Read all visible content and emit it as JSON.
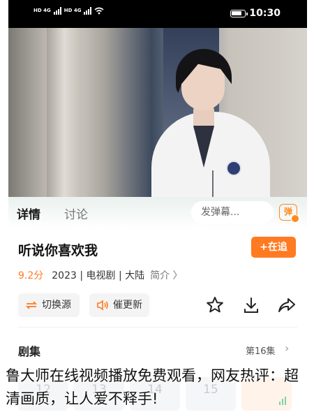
{
  "status_bar": {
    "signal_left": "HD 4G",
    "signal_right": "HD 4G",
    "time": "10:30"
  },
  "tabs": {
    "active_label": "详情",
    "inactive_label": "讨论"
  },
  "danmaku": {
    "placeholder": "发弹幕...",
    "toggle_label": "弹"
  },
  "show": {
    "title": "听说你喜欢我",
    "follow_label": "+在追",
    "rating": "9.2分",
    "meta": "2023 | 电视剧 | 大陆",
    "intro_label": "简介 〉"
  },
  "actions": {
    "switch_source_label": "切换源",
    "urge_update_label": "催更新",
    "icons": [
      "star-icon",
      "download-icon",
      "share-icon"
    ]
  },
  "episodes": {
    "title": "剧集",
    "current_label": "第16集",
    "items": [
      "12",
      "13",
      "14",
      "15",
      ""
    ]
  },
  "caption": "鲁大师在线视频播放免费观看，网友热评：超清画质，让人爱不释手!",
  "colors": {
    "accent": "#ff7a21",
    "tabs_tint": "#eaf1ef"
  }
}
